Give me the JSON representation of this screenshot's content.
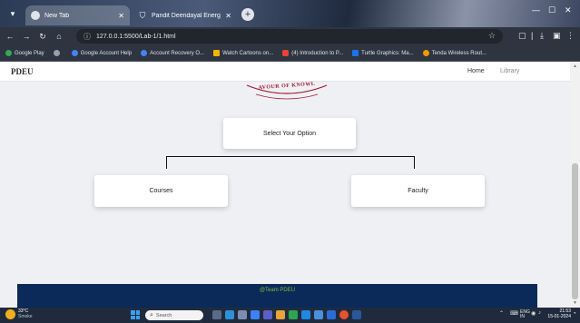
{
  "browser": {
    "tabs": [
      {
        "title": "New Tab",
        "active": true
      },
      {
        "title": "Pandit Deendayal Energy Unive...",
        "active": false
      }
    ],
    "new_tab_symbol": "+",
    "url": "127.0.0.1:5500/Lab-1/1.html",
    "bookmarks": [
      {
        "label": "Google Play",
        "color": "#34a853"
      },
      {
        "label": "",
        "color": "#9aa0a6"
      },
      {
        "label": "Google Account Help",
        "color": "#4285f4"
      },
      {
        "label": "Account Recovery O...",
        "color": "#4285f4"
      },
      {
        "label": "Watch Cartoons on...",
        "color": "#f4b400"
      },
      {
        "label": "(4) Introduction to P...",
        "color": "#ea4335"
      },
      {
        "label": "Turtle Graphics: Ma...",
        "color": "#1a73e8"
      },
      {
        "label": "Tenda Wireless Rout...",
        "color": "#f29900"
      }
    ]
  },
  "page": {
    "brand": "PDEU",
    "nav": {
      "home": "Home",
      "library": "Library"
    },
    "logo_text": "AVOUR OF KNOWL",
    "select_label": "Select Your Option",
    "options": {
      "courses": "Courses",
      "faculty": "Faculty"
    },
    "footer": "@Team PDEU"
  },
  "taskbar": {
    "weather_temp": "33°C",
    "weather_cond": "Smoke",
    "search_placeholder": "Search",
    "lang_top": "ENG",
    "lang_bottom": "IN",
    "time": "21:53",
    "date": "15-01-2024"
  },
  "colors": {
    "footer_bg": "#0b2a5a",
    "footer_text": "#7fbf3f",
    "logo_red": "#a5182a"
  }
}
